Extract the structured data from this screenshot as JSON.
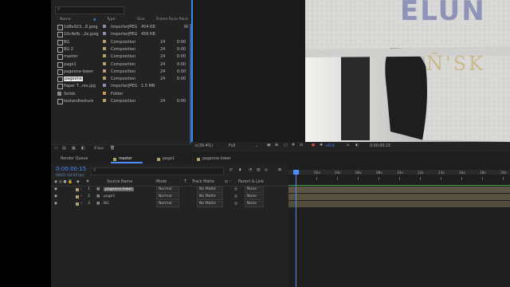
{
  "project": {
    "columns": [
      "Name",
      "Type",
      "Size",
      "Frame Ra...",
      "In Point"
    ],
    "items": [
      {
        "name": "1d8e923...8.jpeg",
        "type": "ImporterJPEG",
        "size": "454 KB",
        "fps": "",
        "in": "",
        "icon": "image-icon",
        "color": "#8b8bb3"
      },
      {
        "name": "10c4efb...2e.jpeg",
        "type": "ImporterJPEG",
        "size": "456 KB",
        "fps": "",
        "in": "",
        "icon": "image-icon",
        "color": "#8b8bb3"
      },
      {
        "name": "BG",
        "type": "Composition",
        "size": "",
        "fps": "24",
        "in": "0:00",
        "icon": "composition-icon",
        "color": "#b3a06b"
      },
      {
        "name": "BG 2",
        "type": "Composition",
        "size": "",
        "fps": "24",
        "in": "0:00",
        "icon": "composition-icon",
        "color": "#b3a06b"
      },
      {
        "name": "master",
        "type": "Composition",
        "size": "",
        "fps": "24",
        "in": "0:00",
        "icon": "composition-icon",
        "color": "#b3a06b"
      },
      {
        "name": "page1",
        "type": "Composition",
        "size": "",
        "fps": "24",
        "in": "0:00",
        "icon": "composition-icon",
        "color": "#b3a06b"
      },
      {
        "name": "pageone-lower",
        "type": "Composition",
        "size": "",
        "fps": "24",
        "in": "0:00",
        "icon": "composition-icon",
        "color": "#b3a06b"
      },
      {
        "name": "pageone",
        "type": "Composition",
        "size": "",
        "fps": "24",
        "in": "0:00",
        "icon": "composition-icon",
        "color": "#b3a06b",
        "editing": true
      },
      {
        "name": "Paper T...res.jpg",
        "type": "ImporterJPEG",
        "size": "1.5 MB",
        "fps": "",
        "in": "",
        "icon": "image-icon",
        "color": "#8b8bb3"
      },
      {
        "name": "Solids",
        "type": "Folder",
        "size": "",
        "fps": "",
        "in": "",
        "icon": "folder-icon",
        "color": "#c9a04a"
      },
      {
        "name": "textandtexture",
        "type": "Composition",
        "size": "",
        "fps": "24",
        "in": "0:00",
        "icon": "composition-icon",
        "color": "#b3a06b"
      }
    ],
    "footer_bpc": "8 bpc"
  },
  "viewer": {
    "zoom": "(39.4%)",
    "resolution": "Full",
    "plus_value": "+0.0",
    "timecode": "0:00:00:15",
    "big_text": "ELUN",
    "script_text": "Ñ'SK"
  },
  "timeline": {
    "tabs": [
      "Render Queue",
      "master",
      "page1",
      "pageone-lower"
    ],
    "current_time": "0:00:00:15",
    "current_frames": "00015 (24.00 fps)",
    "columns": [
      "Source Name",
      "Mode",
      "T",
      "Track Matte",
      "Parent & Link"
    ],
    "layers": [
      {
        "num": "1",
        "name": "pageone-lower",
        "mode": "Normal",
        "matte": "No Matte",
        "parent": "None",
        "color": "#b3a06b"
      },
      {
        "num": "2",
        "name": "page1",
        "mode": "Normal",
        "matte": "No Matte",
        "parent": "None",
        "color": "#b3a06b"
      },
      {
        "num": "3",
        "name": "BG",
        "mode": "Normal",
        "matte": "No Matte",
        "parent": "None",
        "color": "#b3a06b"
      }
    ],
    "ruler": [
      "00s",
      "02s",
      "04s",
      "06s",
      "08s",
      "10s",
      "12s",
      "14s",
      "16s",
      "18s",
      "20s"
    ]
  },
  "colors": {
    "accent": "#2d8ceb",
    "timecode": "#4b8fff",
    "layer_bar": "#5c5546",
    "active_row": "#6a6a6a"
  }
}
